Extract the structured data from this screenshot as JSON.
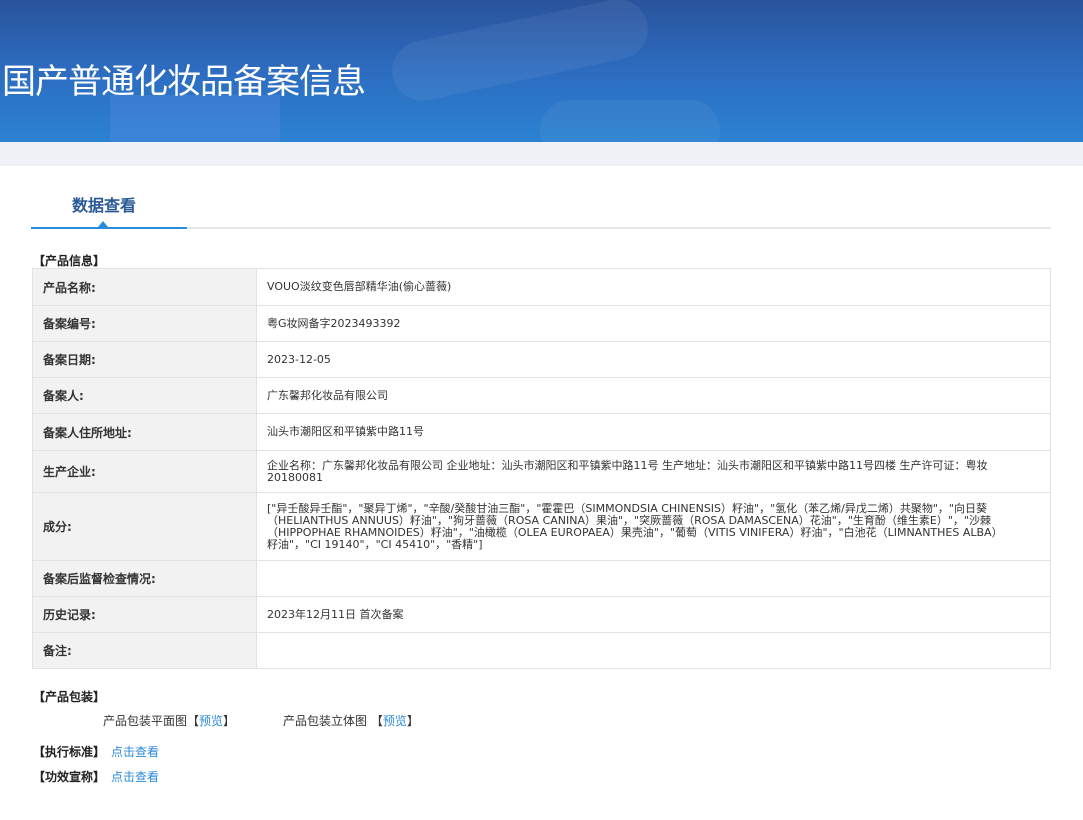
{
  "header": {
    "title": "国产普通化妆品备案信息"
  },
  "tab": {
    "label": "数据查看"
  },
  "product_info": {
    "section": "【产品信息】",
    "rows": [
      {
        "label": "产品名称:",
        "value": "VOUO淡纹变色唇部精华油(偷心蔷薇)"
      },
      {
        "label": "备案编号:",
        "value": "粤G妆网备字2023493392"
      },
      {
        "label": "备案日期:",
        "value": "2023-12-05"
      },
      {
        "label": "备案人:",
        "value": "广东馨邦化妆品有限公司"
      },
      {
        "label": "备案人住所地址:",
        "value": "汕头市潮阳区和平镇紫中路11号"
      },
      {
        "label": "生产企业:",
        "value": "企业名称：广东馨邦化妆品有限公司 企业地址：汕头市潮阳区和平镇紫中路11号 生产地址：汕头市潮阳区和平镇紫中路11号四楼 生产许可证：粤妆20180081"
      },
      {
        "label": "成分:",
        "value": "[\"异壬酸异壬酯\"，\"聚异丁烯\"，\"辛酸/癸酸甘油三酯\"，\"霍霍巴（SIMMONDSIA CHINENSIS）籽油\"，\"氢化（苯乙烯/异戊二烯）共聚物\"，\"向日葵（HELIANTHUS ANNUUS）籽油\"，\"狗牙蔷薇（ROSA CANINA）果油\"，\"突厥蔷薇（ROSA DAMASCENA）花油\"，\"生育酚（维生素E）\"，\"沙棘（HIPPOPHAE RHAMNOIDES）籽油\"，\"油橄榄（OLEA EUROPAEA）果壳油\"，\"葡萄（VITIS VINIFERA）籽油\"，\"白池花（LIMNANTHES ALBA）籽油\"，\"CI 19140\"，\"CI 45410\"，\"香精\"]"
      },
      {
        "label": "备案后监督检查情况:",
        "value": ""
      },
      {
        "label": "历史记录:",
        "value": "2023年12月11日 首次备案"
      },
      {
        "label": "备注:",
        "value": ""
      }
    ]
  },
  "packaging": {
    "section": "【产品包装】",
    "flat_label": "产品包装平面图",
    "solid_label": "产品包装立体图",
    "bracket_open": "【",
    "bracket_close": "】",
    "preview": "预览"
  },
  "standard": {
    "section": "【执行标准】",
    "link": "点击查看"
  },
  "efficacy": {
    "section": "【功效宣称】",
    "link": "点击查看"
  }
}
